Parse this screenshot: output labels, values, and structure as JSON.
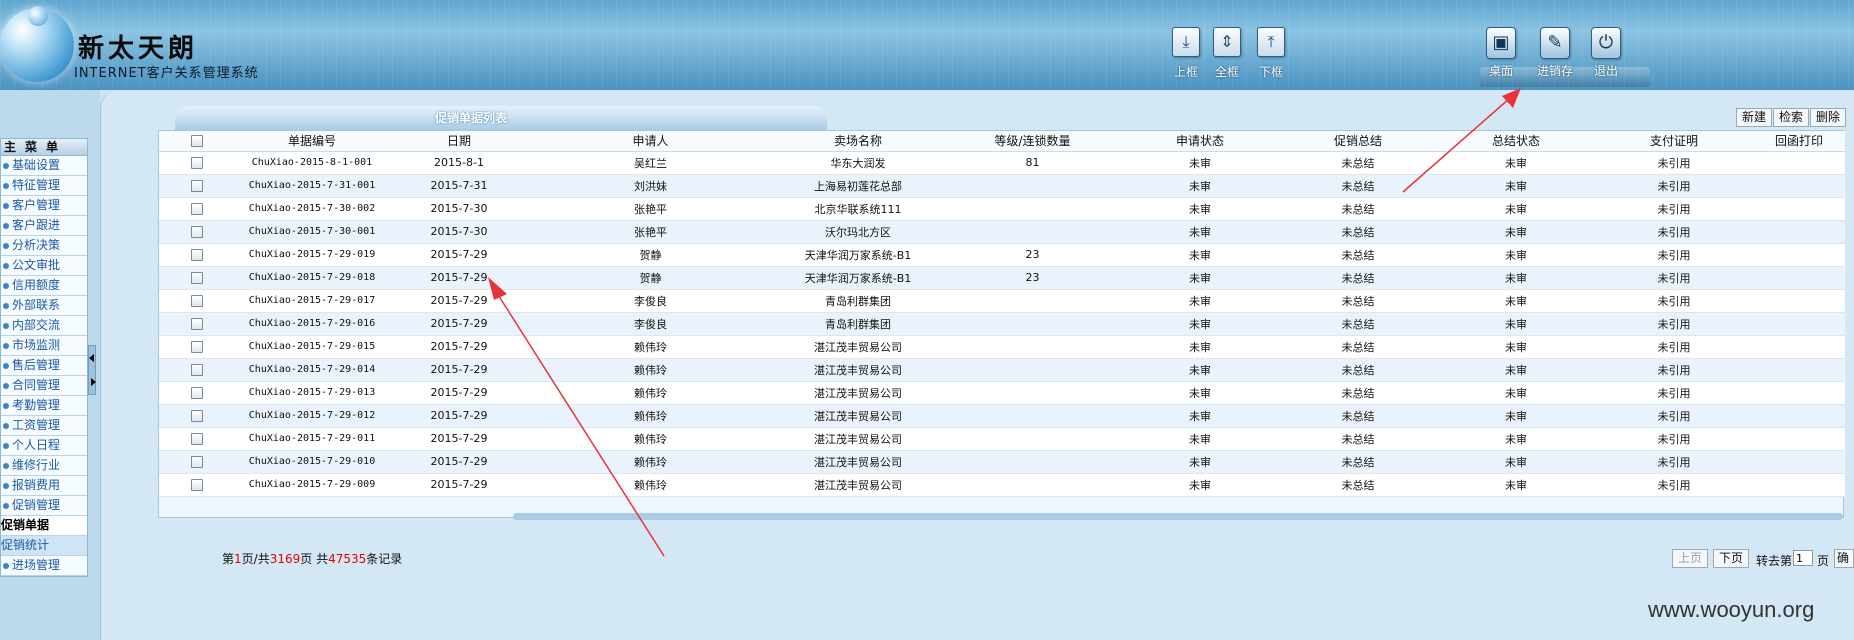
{
  "brand": {
    "title": "新太天朗",
    "subtitle": "INTERNET客户关系管理系统"
  },
  "header_nav": [
    {
      "label": "上框",
      "icon": "frame-up-icon"
    },
    {
      "label": "全框",
      "icon": "frame-full-icon"
    },
    {
      "label": "下框",
      "icon": "frame-down-icon"
    }
  ],
  "header_actions": [
    {
      "label": "桌面",
      "icon": "desktop-icon"
    },
    {
      "label": "进销存",
      "icon": "inventory-icon"
    },
    {
      "label": "退出",
      "icon": "exit-icon"
    }
  ],
  "sidebar": {
    "title": "主菜单",
    "items": [
      {
        "label": "基础设置",
        "state": "normal"
      },
      {
        "label": "特征管理",
        "state": "normal"
      },
      {
        "label": "客户管理",
        "state": "normal"
      },
      {
        "label": "客户跟进",
        "state": "normal"
      },
      {
        "label": "分析决策",
        "state": "normal"
      },
      {
        "label": "公文审批",
        "state": "normal"
      },
      {
        "label": "信用额度",
        "state": "normal"
      },
      {
        "label": "外部联系",
        "state": "normal"
      },
      {
        "label": "内部交流",
        "state": "normal"
      },
      {
        "label": "市场监测",
        "state": "normal"
      },
      {
        "label": "售后管理",
        "state": "normal"
      },
      {
        "label": "合同管理",
        "state": "normal"
      },
      {
        "label": "考勤管理",
        "state": "normal"
      },
      {
        "label": "工资管理",
        "state": "normal"
      },
      {
        "label": "个人日程",
        "state": "normal"
      },
      {
        "label": "维修行业",
        "state": "normal"
      },
      {
        "label": "报销费用",
        "state": "normal"
      },
      {
        "label": "促销管理",
        "state": "normal"
      },
      {
        "label": "促销单据",
        "state": "active"
      },
      {
        "label": "促销统计",
        "state": "sub"
      },
      {
        "label": "进场管理",
        "state": "normal"
      }
    ]
  },
  "panel": {
    "title": "促销单据列表",
    "buttons": {
      "new": "新建",
      "search": "检索",
      "delete": "删除"
    }
  },
  "table": {
    "columns": [
      "单据编号",
      "日期",
      "申请人",
      "卖场名称",
      "等级/连锁数量",
      "申请状态",
      "促销总结",
      "总结状态",
      "支付证明",
      "回函打印"
    ],
    "rows": [
      [
        "ChuXiao-2015-8-1-001",
        "2015-8-1",
        "吴红兰",
        "华东大润发",
        "81",
        "未审",
        "未总结",
        "未审",
        "未引用",
        ""
      ],
      [
        "ChuXiao-2015-7-31-001",
        "2015-7-31",
        "刘洪妹",
        "上海易初莲花总部",
        "",
        "未审",
        "未总结",
        "未审",
        "未引用",
        ""
      ],
      [
        "ChuXiao-2015-7-30-002",
        "2015-7-30",
        "张艳平",
        "北京华联系统111",
        "",
        "未审",
        "未总结",
        "未审",
        "未引用",
        ""
      ],
      [
        "ChuXiao-2015-7-30-001",
        "2015-7-30",
        "张艳平",
        "沃尔玛北方区",
        "",
        "未审",
        "未总结",
        "未审",
        "未引用",
        ""
      ],
      [
        "ChuXiao-2015-7-29-019",
        "2015-7-29",
        "贺静",
        "天津华润万家系统-B1",
        "23",
        "未审",
        "未总结",
        "未审",
        "未引用",
        ""
      ],
      [
        "ChuXiao-2015-7-29-018",
        "2015-7-29",
        "贺静",
        "天津华润万家系统-B1",
        "23",
        "未审",
        "未总结",
        "未审",
        "未引用",
        ""
      ],
      [
        "ChuXiao-2015-7-29-017",
        "2015-7-29",
        "李俊良",
        "青岛利群集团",
        "",
        "未审",
        "未总结",
        "未审",
        "未引用",
        ""
      ],
      [
        "ChuXiao-2015-7-29-016",
        "2015-7-29",
        "李俊良",
        "青岛利群集团",
        "",
        "未审",
        "未总结",
        "未审",
        "未引用",
        ""
      ],
      [
        "ChuXiao-2015-7-29-015",
        "2015-7-29",
        "赖伟玲",
        "湛江茂丰贸易公司",
        "",
        "未审",
        "未总结",
        "未审",
        "未引用",
        ""
      ],
      [
        "ChuXiao-2015-7-29-014",
        "2015-7-29",
        "赖伟玲",
        "湛江茂丰贸易公司",
        "",
        "未审",
        "未总结",
        "未审",
        "未引用",
        ""
      ],
      [
        "ChuXiao-2015-7-29-013",
        "2015-7-29",
        "赖伟玲",
        "湛江茂丰贸易公司",
        "",
        "未审",
        "未总结",
        "未审",
        "未引用",
        ""
      ],
      [
        "ChuXiao-2015-7-29-012",
        "2015-7-29",
        "赖伟玲",
        "湛江茂丰贸易公司",
        "",
        "未审",
        "未总结",
        "未审",
        "未引用",
        ""
      ],
      [
        "ChuXiao-2015-7-29-011",
        "2015-7-29",
        "赖伟玲",
        "湛江茂丰贸易公司",
        "",
        "未审",
        "未总结",
        "未审",
        "未引用",
        ""
      ],
      [
        "ChuXiao-2015-7-29-010",
        "2015-7-29",
        "赖伟玲",
        "湛江茂丰贸易公司",
        "",
        "未审",
        "未总结",
        "未审",
        "未引用",
        ""
      ],
      [
        "ChuXiao-2015-7-29-009",
        "2015-7-29",
        "赖伟玲",
        "湛江茂丰贸易公司",
        "",
        "未审",
        "未总结",
        "未审",
        "未引用",
        ""
      ]
    ]
  },
  "pagination": {
    "prefix": "第",
    "current_page": "1",
    "page_sep": "页/共",
    "total_pages": "3169",
    "pages_suffix": "页 共",
    "total_records": "47535",
    "records_suffix": "条记录",
    "prev": "上页",
    "next": "下页",
    "goto_prefix": "转去第",
    "goto_value": "1",
    "goto_suffix": "页",
    "confirm": "确认"
  },
  "watermark": "www.wooyun.org",
  "colors": {
    "accent": "#4a92c0",
    "highlight_red": "#e60000",
    "annotation_arrow": "#e8333a"
  }
}
